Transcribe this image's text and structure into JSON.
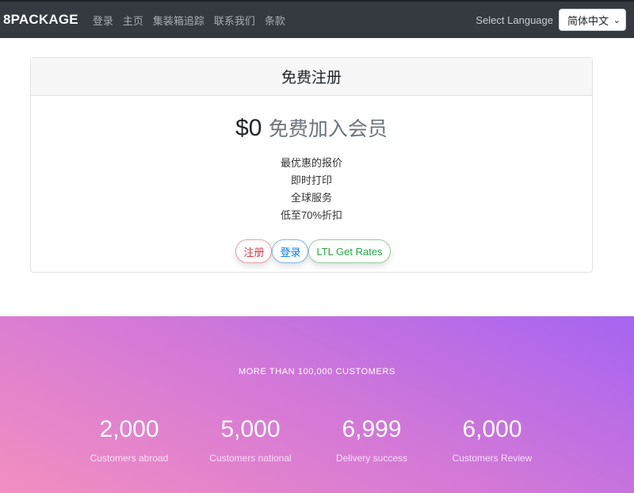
{
  "navbar": {
    "brand": "8PACKAGE",
    "links": [
      "登录",
      "主页",
      "集装箱追踪",
      "联系我们",
      "条款"
    ],
    "language_label": "Select Language",
    "language_value": "简体中文"
  },
  "pricing_card": {
    "header": "免费注册",
    "price": "$0",
    "price_subtitle": "免费加入会员",
    "features": [
      "最优惠的报价",
      "即时打印",
      "全球服务",
      "低至70%折扣"
    ],
    "buttons": {
      "register": "注册",
      "login": "登录",
      "ltl": "LTL Get Rates"
    }
  },
  "stats": {
    "heading": "MORE THAN 100,000 CUSTOMERS",
    "items": [
      {
        "value": "2,000",
        "label": "Customers abroad"
      },
      {
        "value": "5,000",
        "label": "Customers national"
      },
      {
        "value": "6,999",
        "label": "Delivery success"
      },
      {
        "value": "6,000",
        "label": "Customers Review"
      }
    ]
  },
  "colors": {
    "navbar_bg": "#343a40",
    "gradient_start": "#f28fc0",
    "gradient_end": "#a664f1",
    "btn_red": "#dc3545",
    "btn_blue": "#007bff",
    "btn_green": "#28a745"
  },
  "icons": {
    "language_select": "chevron-down-icon"
  }
}
